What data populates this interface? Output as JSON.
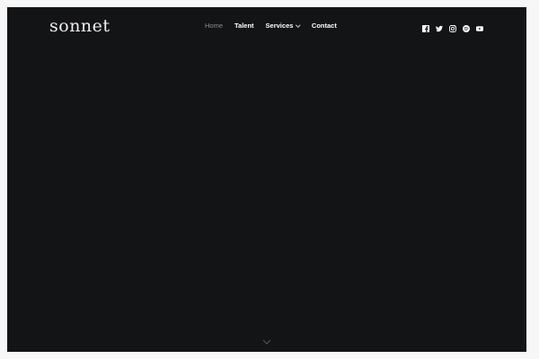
{
  "brand": {
    "logo_text": "sonnet"
  },
  "nav": {
    "items": [
      {
        "label": "Home",
        "active": true
      },
      {
        "label": "Talent"
      },
      {
        "label": "Services"
      },
      {
        "label": "Contact"
      }
    ]
  },
  "social": {
    "icons": [
      "facebook-icon",
      "twitter-icon",
      "instagram-icon",
      "spotify-icon",
      "youtube-icon"
    ]
  },
  "scroll": {
    "icon": "chevron-down-icon"
  },
  "colors": {
    "background": "#131416",
    "page": "#f7f7f7",
    "nav_active": "#8c8c8c",
    "text": "#ffffff"
  }
}
